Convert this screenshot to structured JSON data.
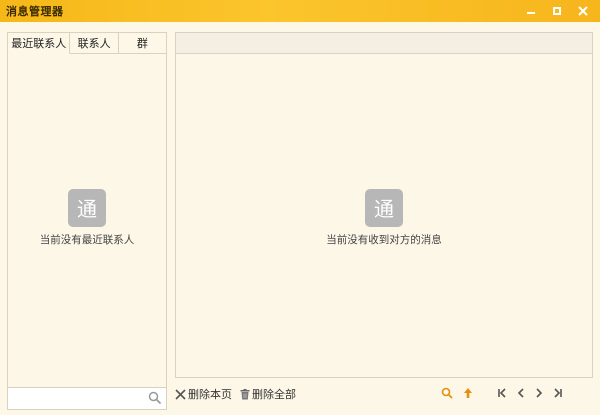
{
  "window": {
    "title": "消息管理器",
    "controls": {
      "minimize": "minimize-icon",
      "maximize": "maximize-icon",
      "close": "close-icon"
    }
  },
  "left": {
    "tabs": [
      {
        "label": "最近联系人",
        "active": true
      },
      {
        "label": "联系人",
        "active": false
      },
      {
        "label": "群",
        "active": false
      }
    ],
    "empty_icon_glyph": "通",
    "empty_text": "当前没有最近联系人",
    "search": {
      "value": "",
      "placeholder": ""
    }
  },
  "right": {
    "empty_icon_glyph": "通",
    "empty_text": "当前没有收到对方的消息"
  },
  "toolbar": {
    "delete_page_label": "删除本页",
    "delete_all_label": "删除全部"
  },
  "colors": {
    "titlebar": "#f8bd22",
    "panel_bg": "#fdf7e8",
    "border": "#d9d2c0",
    "accent_orange": "#e6900f",
    "icon_gray": "#b7b7b7"
  }
}
